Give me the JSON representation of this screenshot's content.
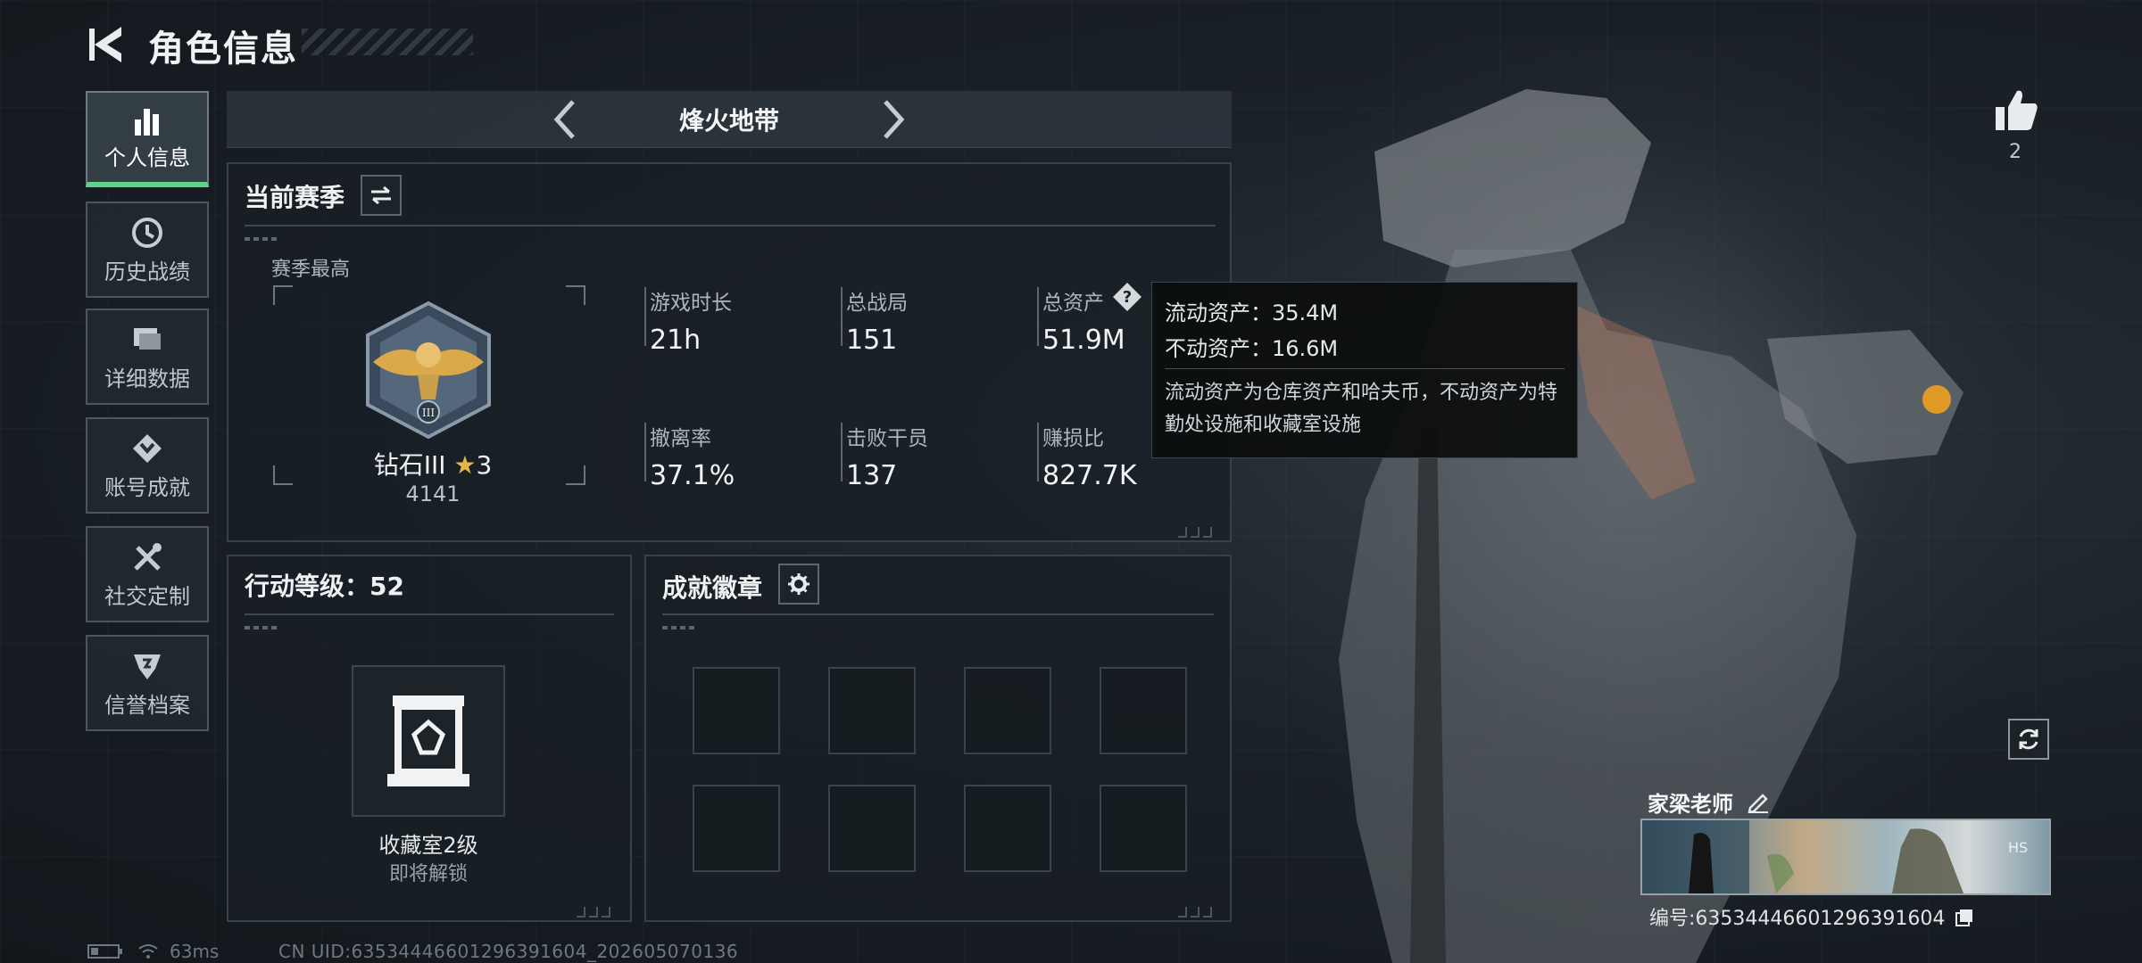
{
  "header": {
    "title": "角色信息"
  },
  "sidebar": {
    "items": [
      {
        "label": "个人信息",
        "icon": "bar-chart-icon",
        "active": true
      },
      {
        "label": "历史战绩",
        "icon": "history-clock-icon",
        "active": false
      },
      {
        "label": "详细数据",
        "icon": "folder-icon",
        "active": false
      },
      {
        "label": "账号成就",
        "icon": "achievement-icon",
        "active": false
      },
      {
        "label": "社交定制",
        "icon": "tools-icon",
        "active": false
      },
      {
        "label": "信誉档案",
        "icon": "reputation-shield-icon",
        "active": false
      }
    ]
  },
  "season_nav": {
    "name": "烽火地带"
  },
  "season_panel": {
    "title": "当前赛季",
    "best_label": "赛季最高",
    "rank": {
      "name": "钻石III",
      "stars": "3",
      "score": "4141"
    },
    "stats": [
      {
        "label": "游戏时长",
        "value": "21h"
      },
      {
        "label": "总战局",
        "value": "151"
      },
      {
        "label": "总资产",
        "value": "51.9M"
      },
      {
        "label": "撤离率",
        "value": "37.1%"
      },
      {
        "label": "击败干员",
        "value": "137"
      },
      {
        "label": "赚损比",
        "value": "827.7K"
      }
    ]
  },
  "tooltip": {
    "liquid": "流动资产：35.4M",
    "fixed": "不动资产：16.6M",
    "description": "流动资产为仓库资产和哈夫币，不动资产为特勤处设施和收藏室设施"
  },
  "action_panel": {
    "title": "行动等级：52",
    "vault_title": "收藏室2级",
    "vault_sub": "即将解锁"
  },
  "badge_panel": {
    "title": "成就徽章"
  },
  "likes": {
    "count": "2"
  },
  "player_card": {
    "name": "家梁老师",
    "id_text": "编号:63534446601296391604"
  },
  "status": {
    "ping": "63ms",
    "uid": "CN UID:63534446601296391604_202605070136"
  },
  "colors": {
    "accent_green": "#5ed38a",
    "gold_star": "#e2b649"
  }
}
